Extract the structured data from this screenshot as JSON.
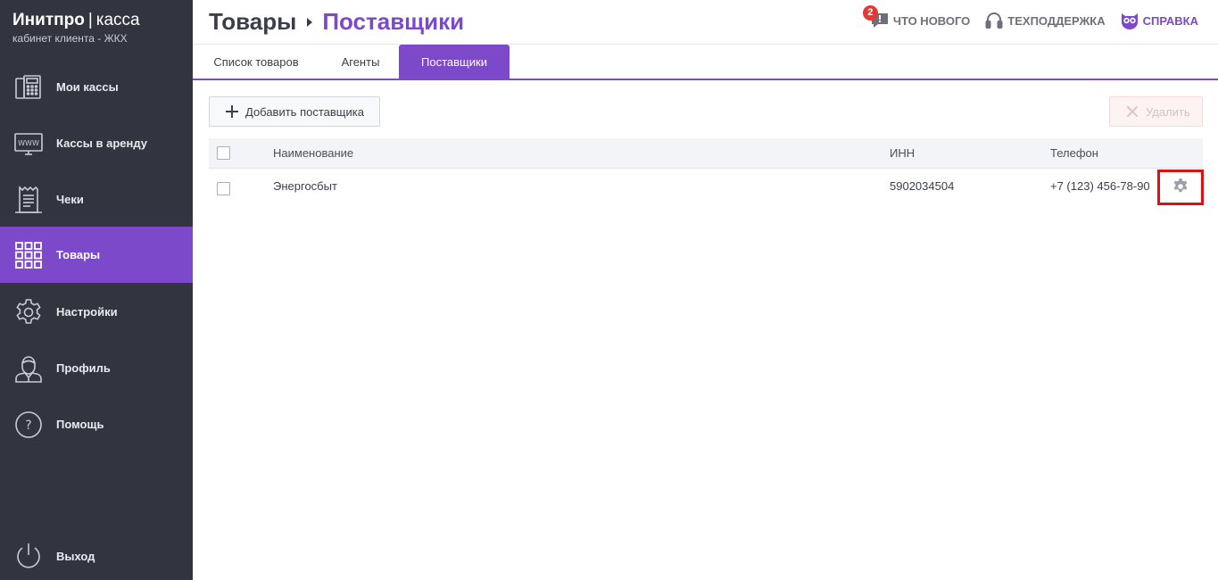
{
  "brand": {
    "name": "Инитпро",
    "separator": "|",
    "product": "касса",
    "subtitle": "кабинет клиента - ЖКХ"
  },
  "sidebar": {
    "items": [
      {
        "label": "Мои кассы",
        "icon": "fax-icon",
        "active": false
      },
      {
        "label": "Кассы в аренду",
        "icon": "monitor-www-icon",
        "active": false
      },
      {
        "label": "Чеки",
        "icon": "receipt-icon",
        "active": false
      },
      {
        "label": "Товары",
        "icon": "grid-icon",
        "active": true
      },
      {
        "label": "Настройки",
        "icon": "gear-icon",
        "active": false
      },
      {
        "label": "Профиль",
        "icon": "user-icon",
        "active": false
      },
      {
        "label": "Помощь",
        "icon": "question-icon",
        "active": false
      }
    ],
    "logout": {
      "label": "Выход",
      "icon": "power-icon"
    }
  },
  "header": {
    "breadcrumb_parent": "Товары",
    "breadcrumb_current": "Поставщики",
    "links": {
      "whats_new": "ЧТО НОВОГО",
      "whats_new_badge": "2",
      "support": "ТЕХПОДДЕРЖКА",
      "help": "СПРАВКА"
    }
  },
  "tabs": [
    {
      "label": "Список товаров",
      "active": false
    },
    {
      "label": "Агенты",
      "active": false
    },
    {
      "label": "Поставщики",
      "active": true
    }
  ],
  "toolbar": {
    "add_label": "Добавить поставщика",
    "delete_label": "Удалить"
  },
  "table": {
    "columns": [
      "Наименование",
      "ИНН",
      "Телефон"
    ],
    "rows": [
      {
        "name": "Энергосбыт",
        "inn": "5902034504",
        "phone": "+7 (123) 456-78-90"
      }
    ]
  },
  "colors": {
    "accent": "#7b49c9",
    "sidebar_bg": "#32353f",
    "highlight_box": "#e20f0f",
    "badge": "#e53935"
  }
}
